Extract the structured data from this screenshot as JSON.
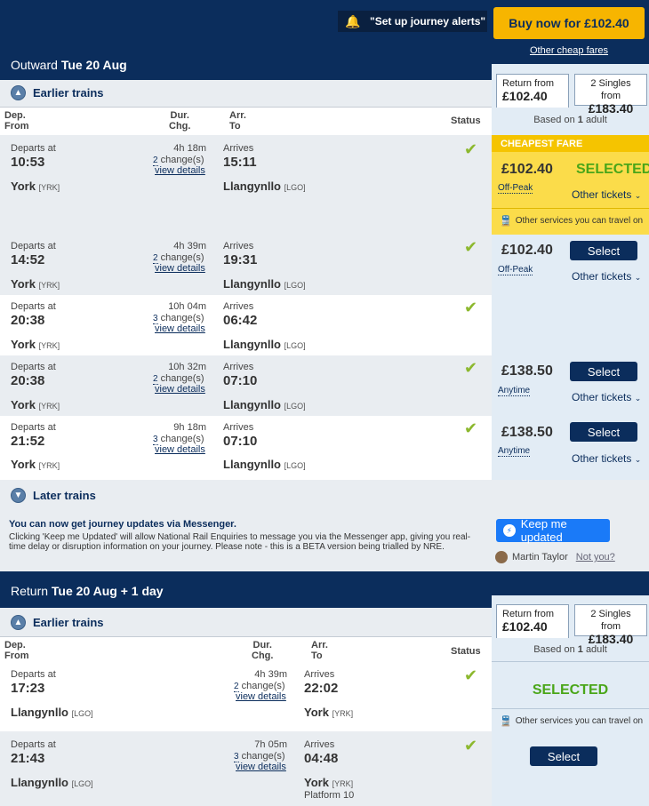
{
  "top": {
    "alert_label": "\"Set up journey alerts\"",
    "buy_label": "Buy now for £102.40",
    "cheap_fares": "Other cheap fares"
  },
  "outward": {
    "label": "Outward",
    "date": "Tue 20 Aug",
    "earlier": "Earlier trains",
    "later": "Later trains",
    "headers": {
      "dep": "Dep.",
      "from": "From",
      "dur": "Dur.",
      "chg": "Chg.",
      "arr": "Arr.",
      "to": "To",
      "status": "Status"
    },
    "fare_tabs": {
      "return_from": "Return from",
      "return_price": "£102.40",
      "singles_from": "2 Singles from",
      "singles_price": "£183.40"
    },
    "based_on": "Based on",
    "based_count": "1",
    "based_suffix": "adult",
    "cheapest": "CHEAPEST FARE",
    "other_services": "Other services you can travel on",
    "rows": [
      {
        "dep_label": "Departs at",
        "dep": "10:53",
        "dur": "4h 18m",
        "changes": "2",
        "change_label": "change(s)",
        "details": "view details",
        "arr_label": "Arrives",
        "arr": "15:11",
        "from": "York",
        "from_code": "[YRK]",
        "to": "Llangynllo",
        "to_code": "[LGO]",
        "price": "£102.40",
        "fare": "Off-Peak",
        "action": "SELECTED",
        "other": "Other tickets"
      },
      {
        "dep_label": "Departs at",
        "dep": "14:52",
        "dur": "4h 39m",
        "changes": "2",
        "change_label": "change(s)",
        "details": "view details",
        "arr_label": "Arrives",
        "arr": "19:31",
        "from": "York",
        "from_code": "[YRK]",
        "to": "Llangynllo",
        "to_code": "[LGO]",
        "price": "£102.40",
        "fare": "Off-Peak",
        "action": "Select",
        "other": "Other tickets"
      },
      {
        "dep_label": "Departs at",
        "dep": "20:38",
        "dur": "10h 04m",
        "changes": "3",
        "change_label": "change(s)",
        "details": "view details",
        "arr_label": "Arrives",
        "arr": "06:42",
        "from": "York",
        "from_code": "[YRK]",
        "to": "Llangynllo",
        "to_code": "[LGO]"
      },
      {
        "dep_label": "Departs at",
        "dep": "20:38",
        "dur": "10h 32m",
        "changes": "2",
        "change_label": "change(s)",
        "details": "view details",
        "arr_label": "Arrives",
        "arr": "07:10",
        "from": "York",
        "from_code": "[YRK]",
        "to": "Llangynllo",
        "to_code": "[LGO]",
        "price": "£138.50",
        "fare": "Anytime",
        "action": "Select",
        "other": "Other tickets"
      },
      {
        "dep_label": "Departs at",
        "dep": "21:52",
        "dur": "9h 18m",
        "changes": "3",
        "change_label": "change(s)",
        "details": "view details",
        "arr_label": "Arrives",
        "arr": "07:10",
        "from": "York",
        "from_code": "[YRK]",
        "to": "Llangynllo",
        "to_code": "[LGO]",
        "price": "£138.50",
        "fare": "Anytime",
        "action": "Select",
        "other": "Other tickets"
      }
    ]
  },
  "messenger": {
    "title": "You can now get journey updates via Messenger.",
    "body": "Clicking 'Keep me Updated' will allow National Rail Enquiries to message you via the Messenger app, giving you real-time delay or disruption information on your journey. Please note - this is a BETA version being trialled by NRE.",
    "button": "Keep me updated",
    "user": "Martin Taylor",
    "not_you": "Not you?"
  },
  "return": {
    "label": "Return",
    "date": "Tue 20 Aug + 1 day",
    "earlier": "Earlier trains",
    "headers": {
      "dep": "Dep.",
      "from": "From",
      "dur": "Dur.",
      "chg": "Chg.",
      "arr": "Arr.",
      "to": "To",
      "status": "Status"
    },
    "fare_tabs": {
      "return_from": "Return from",
      "return_price": "£102.40",
      "singles_from": "2 Singles from",
      "singles_price": "£183.40"
    },
    "based_on": "Based on",
    "based_count": "1",
    "based_suffix": "adult",
    "other_services": "Other services you can travel on",
    "rows": [
      {
        "dep_label": "Departs at",
        "dep": "17:23",
        "dur": "4h 39m",
        "changes": "2",
        "change_label": "change(s)",
        "details": "view details",
        "arr_label": "Arrives",
        "arr": "22:02",
        "from": "Llangynllo",
        "from_code": "[LGO]",
        "to": "York",
        "to_code": "[YRK]",
        "action": "SELECTED"
      },
      {
        "dep_label": "Departs at",
        "dep": "21:43",
        "dur": "7h 05m",
        "changes": "3",
        "change_label": "change(s)",
        "details": "view details",
        "arr_label": "Arrives",
        "arr": "04:48",
        "from": "Llangynllo",
        "from_code": "[LGO]",
        "to": "York",
        "to_code": "[YRK]",
        "platform": "Platform 10",
        "action": "Select"
      }
    ]
  }
}
